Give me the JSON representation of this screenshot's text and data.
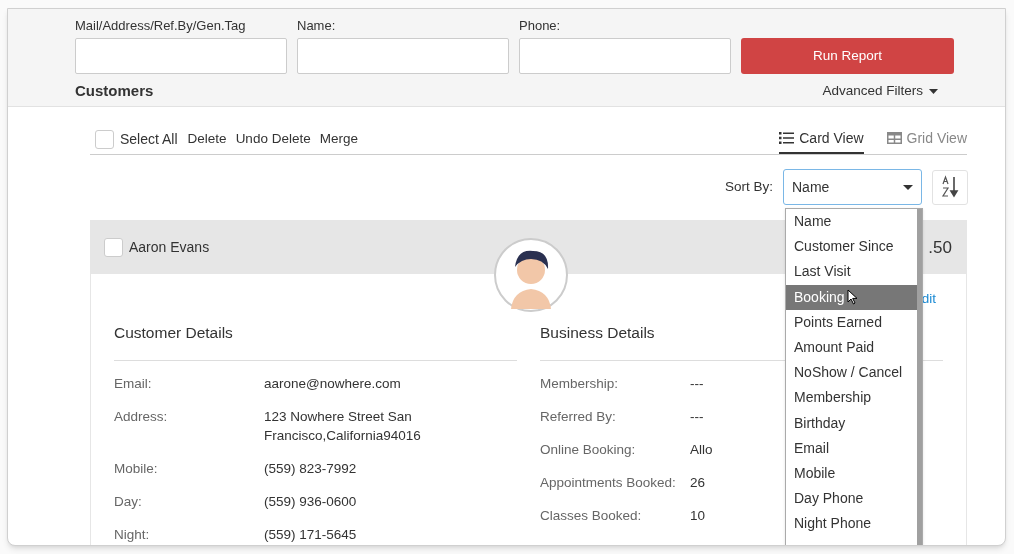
{
  "filters": [
    {
      "label": "Mail/Address/Ref.By/Gen.Tag"
    },
    {
      "label": "Name:"
    },
    {
      "label": "Phone:"
    }
  ],
  "run_button": "Run Report",
  "section_title": "Customers",
  "advanced_filters": "Advanced Filters",
  "select_all": {
    "label": "Select All",
    "checked": false
  },
  "actions": [
    "Delete",
    "Undo Delete",
    "Merge"
  ],
  "views": [
    {
      "kind": "card",
      "label": "Card View",
      "selected": true
    },
    {
      "kind": "grid",
      "label": "Grid View",
      "selected": false
    }
  ],
  "sort": {
    "label": "Sort By:",
    "value": "Name",
    "options": [
      {
        "label": "Name",
        "highlighted": false
      },
      {
        "label": "Customer Since",
        "highlighted": false
      },
      {
        "label": "Last Visit",
        "highlighted": false
      },
      {
        "label": "Booking",
        "highlighted": true
      },
      {
        "label": "Points Earned",
        "highlighted": false
      },
      {
        "label": "Amount Paid",
        "highlighted": false
      },
      {
        "label": "NoShow / Cancel",
        "highlighted": false
      },
      {
        "label": "Membership",
        "highlighted": false
      },
      {
        "label": "Birthday",
        "highlighted": false
      },
      {
        "label": "Email",
        "highlighted": false
      },
      {
        "label": "Mobile",
        "highlighted": false
      },
      {
        "label": "Day Phone",
        "highlighted": false
      },
      {
        "label": "Night Phone",
        "highlighted": false
      }
    ]
  },
  "card": {
    "name": "Aaron Evans",
    "checked": false,
    "amount": ".50",
    "edit_link": "dit",
    "sections": [
      {
        "title": "Customer Details",
        "rows": [
          {
            "label": "Email:",
            "value": "aarone@nowhere.com"
          },
          {
            "label": "Address:",
            "value": "123 Nowhere Street San Francisco,California94016"
          },
          {
            "label": "Mobile:",
            "value": "(559) 823-7992"
          },
          {
            "label": "Day:",
            "value": "(559) 936-0600"
          },
          {
            "label": "Night:",
            "value": "(559) 171-5645"
          }
        ]
      },
      {
        "title": "Business Details",
        "rows": [
          {
            "label": "Membership:",
            "value": "---"
          },
          {
            "label": "Referred By:",
            "value": "---"
          },
          {
            "label": "Online Booking:",
            "value": "Allo"
          },
          {
            "label": "Appointments Booked:",
            "value": "26"
          },
          {
            "label": "Classes Booked:",
            "value": "10"
          }
        ]
      }
    ]
  }
}
